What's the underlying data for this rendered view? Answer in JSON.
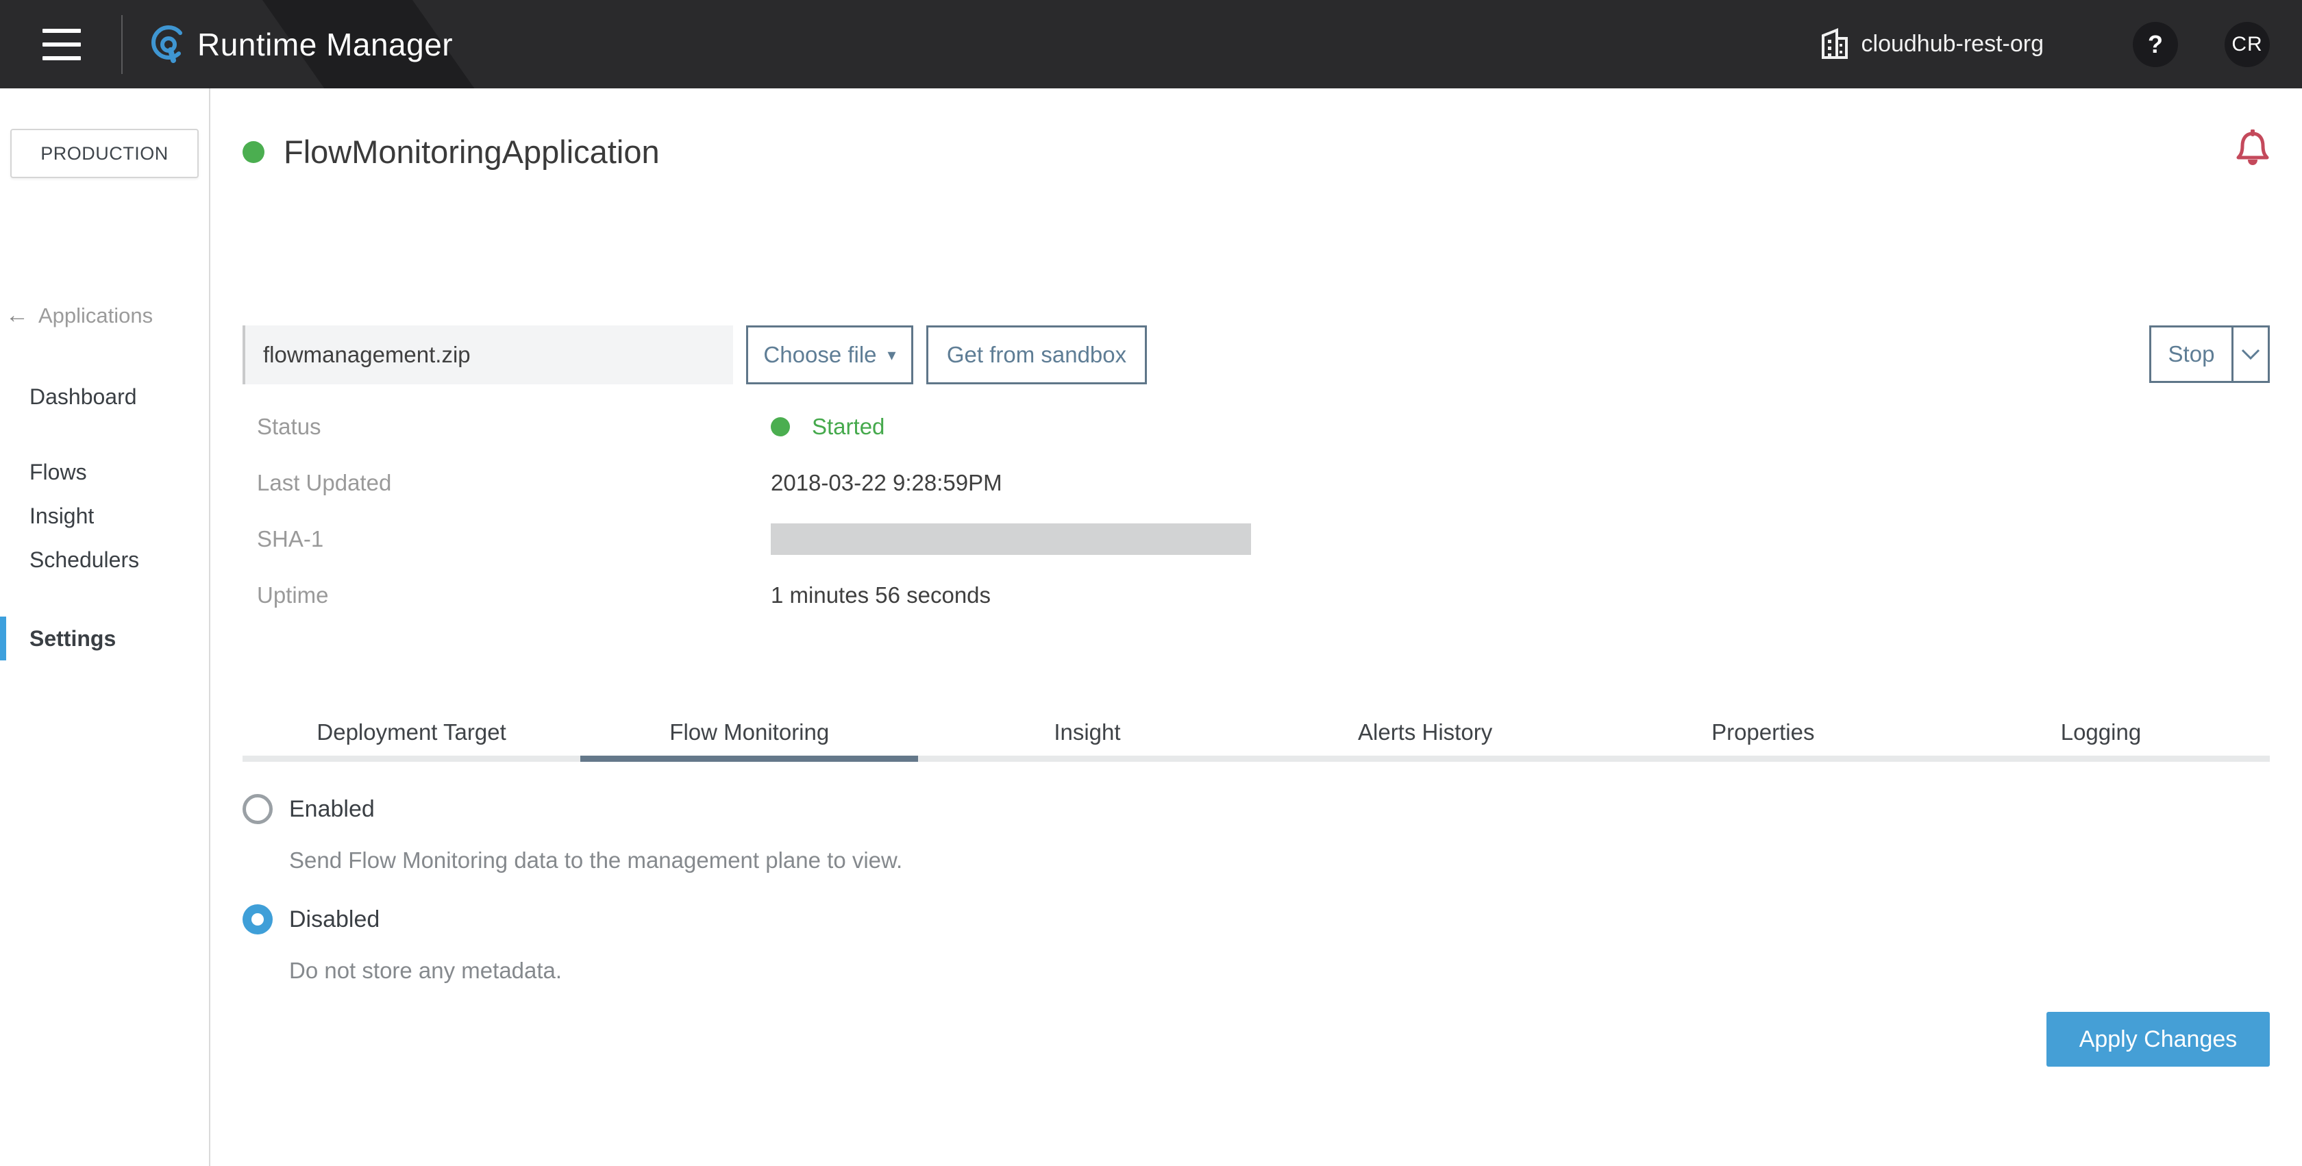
{
  "header": {
    "title": "Runtime Manager",
    "org_name": "cloudhub-rest-org",
    "help_label": "?",
    "avatar_initials": "CR"
  },
  "sidebar": {
    "environment": "PRODUCTION",
    "back_label": "Applications",
    "back_arrow": "←",
    "items": [
      "Dashboard",
      "Flows",
      "Insight",
      "Schedulers",
      "Settings"
    ]
  },
  "application": {
    "name": "FlowMonitoringApplication",
    "file_name": "flowmanagement.zip",
    "choose_file_label": "Choose file",
    "choose_file_caret": "▾",
    "get_from_sandbox_label": "Get from sandbox",
    "stop_label": "Stop"
  },
  "details": {
    "status_label": "Status",
    "status_value": "Started",
    "last_updated_label": "Last Updated",
    "last_updated_value": "2018-03-22 9:28:59PM",
    "sha1_label": "SHA-1",
    "uptime_label": "Uptime",
    "uptime_value": "1 minutes 56 seconds"
  },
  "tabs": [
    "Deployment Target",
    "Flow Monitoring",
    "Insight",
    "Alerts History",
    "Properties",
    "Logging"
  ],
  "active_tab": "Flow Monitoring",
  "flow_monitoring": {
    "enabled_label": "Enabled",
    "enabled_description": "Send Flow Monitoring data to the management plane to view.",
    "disabled_label": "Disabled",
    "disabled_description": "Do not store any metadata.",
    "apply_label": "Apply Changes"
  },
  "colors": {
    "accent_blue": "#459fd6",
    "radio_blue": "#3f9fd8",
    "status_green": "#4bae50",
    "bell_red": "#c4495b",
    "button_slate": "#5e7d95",
    "active_tab_slate": "#64788a",
    "header_dark": "#2a2a2c",
    "sidebar_indicator_blue": "#3da0dd"
  }
}
